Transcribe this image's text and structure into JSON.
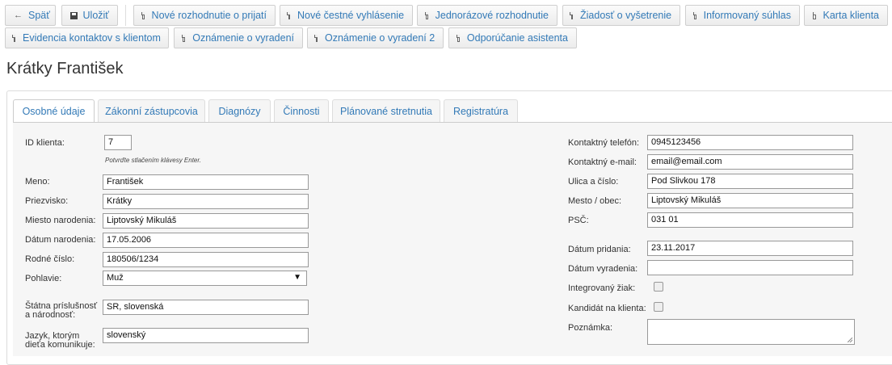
{
  "toolbar": {
    "buttons_row1": [
      {
        "label": "Späť",
        "icon": "arrow-left-icon"
      },
      {
        "label": "Uložiť",
        "icon": "save-icon"
      },
      {
        "label": "Nové rozhodnutie o prijatí",
        "icon": "document-icon"
      },
      {
        "label": "Nové čestné vyhlásenie",
        "icon": "document-icon"
      },
      {
        "label": "Jednorázové rozhodnutie",
        "icon": "document-icon"
      },
      {
        "label": "Žiadosť o vyšetrenie",
        "icon": "document-icon"
      },
      {
        "label": "Informovaný súhlas",
        "icon": "document-icon"
      },
      {
        "label": "Karta klienta",
        "icon": "document-icon"
      }
    ],
    "buttons_row2": [
      {
        "label": "Evidencia kontaktov s klientom",
        "icon": "document-icon"
      },
      {
        "label": "Oznámenie o vyradení",
        "icon": "document-icon"
      },
      {
        "label": "Oznámenie o vyradení 2",
        "icon": "document-icon"
      },
      {
        "label": "Odporúčanie asistenta",
        "icon": "document-icon"
      }
    ]
  },
  "page_title": "Krátky František",
  "tabs": [
    {
      "label": "Osobné údaje",
      "active": true
    },
    {
      "label": "Zákonní zástupcovia",
      "active": false
    },
    {
      "label": "Diagnózy",
      "active": false
    },
    {
      "label": "Činnosti",
      "active": false
    },
    {
      "label": "Plánované stretnutia",
      "active": false
    },
    {
      "label": "Registratúra",
      "active": false
    }
  ],
  "form_left": {
    "id_label": "ID klienta:",
    "id_value": "7",
    "id_hint": "Potvrďte stlačením klávesy Enter.",
    "meno_label": "Meno:",
    "meno_value": "František",
    "priezvisko_label": "Priezvisko:",
    "priezvisko_value": "Krátky",
    "miesto_label": "Miesto narodenia:",
    "miesto_value": "Liptovský Mikuláš",
    "datum_label": "Dátum narodenia:",
    "datum_value": "17.05.2006",
    "rodne_label": "Rodné číslo:",
    "rodne_value": "180506/1234",
    "pohlavie_label": "Pohlavie:",
    "pohlavie_value": "Muž",
    "statna_label_1": "Štátna príslušnosť",
    "statna_label_2": "a národnosť:",
    "statna_value": "SR, slovenská",
    "jazyk_label_1": "Jazyk, ktorým",
    "jazyk_label_2": "dieťa komunikuje:",
    "jazyk_value": "slovenský"
  },
  "form_right": {
    "telefon_label": "Kontaktný telefón:",
    "telefon_value": "0945123456",
    "email_label": "Kontaktný e-mail:",
    "email_value": "email@email.com",
    "ulica_label": "Ulica a číslo:",
    "ulica_value": "Pod Slivkou 178",
    "mesto_label": "Mesto / obec:",
    "mesto_value": "Liptovský Mikuláš",
    "psc_label": "PSČ:",
    "psc_value": "031 01",
    "pridania_label": "Dátum pridania:",
    "pridania_value": "23.11.2017",
    "vyradenia_label": "Dátum vyradenia:",
    "vyradenia_value": "",
    "integrovany_label": "Integrovaný žiak:",
    "integrovany_checked": false,
    "kandidat_label": "Kandidát na klienta:",
    "kandidat_checked": false,
    "poznamka_label": "Poznámka:",
    "poznamka_value": ""
  }
}
